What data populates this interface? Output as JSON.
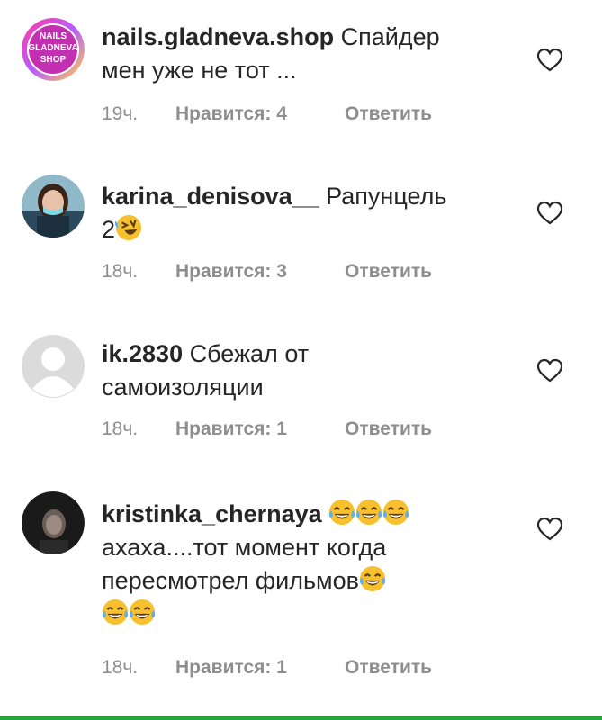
{
  "comments": [
    {
      "username": "nails.gladneva.shop",
      "text_lines": [
        "Спайдер",
        "мен уже не тот ..."
      ],
      "time": "19ч.",
      "likes": "Нравится: 4",
      "reply": "Ответить",
      "avatar": {
        "type": "logo",
        "logo_lines": [
          "NAILS",
          "GLADNEVA",
          "SHOP"
        ]
      }
    },
    {
      "username": "karina_denisova__",
      "text_lines": [
        "Рапунцель",
        "2"
      ],
      "emoji_after_text": [
        "rolling-on-floor-laughing"
      ],
      "time": "18ч.",
      "likes": "Нравится: 3",
      "reply": "Ответить",
      "avatar": {
        "type": "photo"
      }
    },
    {
      "username": "ik.2830",
      "text_lines": [
        "Сбежал от",
        "самоизоляции"
      ],
      "time": "18ч.",
      "likes": "Нравится: 1",
      "reply": "Ответить",
      "avatar": {
        "type": "default"
      }
    },
    {
      "username": "kristinka_chernaya",
      "text_lines": [
        "ахаха....тот момент когда",
        "пересмотрел фильмов"
      ],
      "emoji_after_username": [
        "tears-of-joy",
        "tears-of-joy",
        "tears-of-joy"
      ],
      "emoji_after_text": [
        "tears-of-joy"
      ],
      "emoji_line": [
        "tears-of-joy",
        "tears-of-joy"
      ],
      "time": "18ч.",
      "likes": "Нравится: 1",
      "reply": "Ответить",
      "avatar": {
        "type": "photo-dark"
      }
    }
  ],
  "colors": {
    "meta": "#8e8e8e",
    "text": "#262626",
    "accent_bottom": "#25a53b"
  }
}
